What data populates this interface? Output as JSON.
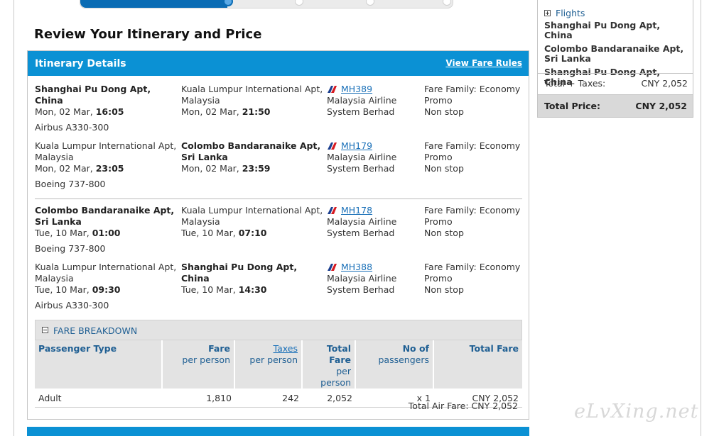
{
  "progress": {
    "fraction": 0.395
  },
  "page_title": "Review Your Itinerary and Price",
  "itinerary": {
    "header_title": "Itinerary Details",
    "fare_rules_link": "View Fare Rules",
    "segments": [
      {
        "dep_airport": "Shanghai Pu Dong Apt, China",
        "dep_date": "Mon, 02 Mar, ",
        "dep_time": "16:05",
        "arr_airport": "Kuala Lumpur International Apt, Malaysia",
        "arr_date": "Mon, 02 Mar, ",
        "arr_time": "21:50",
        "flight": "MH389",
        "airline": "Malaysia Airline System Berhad",
        "fare_family": "Fare Family: Economy Promo",
        "stops": "Non stop",
        "aircraft": "Airbus A330-300"
      },
      {
        "dep_airport": "Kuala Lumpur International Apt, Malaysia",
        "dep_date": "Mon, 02 Mar, ",
        "dep_time": "23:05",
        "arr_airport": "Colombo Bandaranaike Apt, Sri Lanka",
        "arr_date": "Mon, 02 Mar, ",
        "arr_time": "23:59",
        "flight": "MH179",
        "airline": "Malaysia Airline System Berhad",
        "fare_family": "Fare Family: Economy Promo",
        "stops": "Non stop",
        "aircraft": "Boeing 737-800"
      },
      {
        "dep_airport": "Colombo Bandaranaike Apt, Sri Lanka",
        "dep_date": "Tue, 10 Mar, ",
        "dep_time": "01:00",
        "arr_airport": "Kuala Lumpur International Apt, Malaysia",
        "arr_date": "Tue, 10 Mar, ",
        "arr_time": "07:10",
        "flight": "MH178",
        "airline": "Malaysia Airline System Berhad",
        "fare_family": "Fare Family: Economy Promo",
        "stops": "Non stop",
        "aircraft": "Boeing 737-800"
      },
      {
        "dep_airport": "Kuala Lumpur International Apt, Malaysia",
        "dep_date": "Tue, 10 Mar, ",
        "dep_time": "09:30",
        "arr_airport": "Shanghai Pu Dong Apt, China",
        "arr_date": "Tue, 10 Mar, ",
        "arr_time": "14:30",
        "flight": "MH388",
        "airline": "Malaysia Airline System Berhad",
        "fare_family": "Fare Family: Economy Promo",
        "stops": "Non stop",
        "aircraft": "Airbus A330-300"
      }
    ]
  },
  "fare_breakdown": {
    "title": "FARE BREAKDOWN",
    "headers": {
      "passenger_type": "Passenger Type",
      "fare": "Fare",
      "fare_sub": "per person",
      "taxes": "Taxes",
      "taxes_sub": "per person",
      "total_fare_pp": "Total Fare",
      "total_fare_pp_sub": "per person",
      "num_pax": "No of",
      "num_pax_sub": "passengers",
      "total_fare": "Total Fare"
    },
    "rows": [
      {
        "type": "Adult",
        "fare": "1,810",
        "taxes": "242",
        "total_pp": "2,052",
        "count": "x 1",
        "total": "CNY 2,052"
      }
    ],
    "total_air_fare": "Total Air Fare: CNY 2,052"
  },
  "sidebar": {
    "flights_label": "Flights",
    "routes": [
      "Shanghai Pu Dong Apt, China",
      "Colombo Bandaranaike Apt, Sri Lanka",
      "Shanghai Pu Dong Apt, China"
    ],
    "total_taxes_label": "Total + Taxes:",
    "total_taxes_value": "CNY 2,052",
    "total_price_label": "Total Price:",
    "total_price_value": "CNY 2,052"
  },
  "watermark": "eLvXing.net",
  "colors": {
    "header_blue": "#0b91d4",
    "progress_blue": "#0b6cb4",
    "link_blue": "#1a70b8",
    "breakdown_bg": "#e3e3e3"
  },
  "icons": {
    "airline_logo": "malaysia-airlines-logo-icon",
    "collapse": "minus-box-icon",
    "expand": "plus-box-icon"
  }
}
